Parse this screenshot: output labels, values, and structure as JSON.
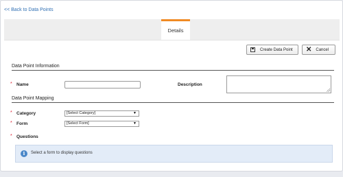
{
  "back_link": "<< Back to Data Points",
  "tabs": [
    {
      "label": "Details"
    }
  ],
  "toolbar": {
    "create_label": "Create Data Point",
    "cancel_label": "Cancel"
  },
  "sections": {
    "info_title": "Data Point Information",
    "mapping_title": "Data Point Mapping"
  },
  "fields": {
    "required_marker": "*",
    "name_label": "Name",
    "description_label": "Description",
    "category_label": "Category",
    "category_value": "[Select Category]",
    "form_label": "Form",
    "form_value": "[Select Form]",
    "questions_label": "Questions"
  },
  "info_message": "Select a form to display questions",
  "colors": {
    "tab_accent": "#f08a24",
    "link": "#2f6fb3",
    "info_bg": "#e3ecf8",
    "required": "#d23"
  }
}
